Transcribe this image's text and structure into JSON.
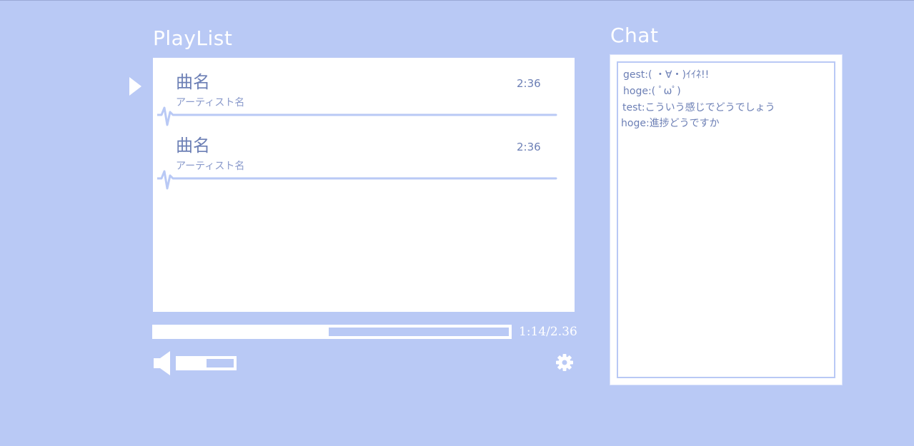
{
  "playlist": {
    "title": "PlayList",
    "tracks": [
      {
        "title": "曲名",
        "artist": "アーティスト名",
        "duration": "2:36"
      },
      {
        "title": "曲名",
        "artist": "アーティスト名",
        "duration": "2:36"
      }
    ],
    "now_playing_index": 0
  },
  "player": {
    "progress_fraction": 0.49,
    "time_readout": "1:14/2.36",
    "volume_fraction": 0.5
  },
  "chat": {
    "title": "Chat",
    "messages": [
      {
        "text": "gest:( ・∀・)ｲｲﾈ!!"
      },
      {
        "text": "hoge:( ﾟωﾟ)"
      },
      {
        "text": "test:こういう感じでどうでしょう"
      },
      {
        "text": "hoge:進捗どうですか"
      }
    ]
  },
  "colors": {
    "background": "#b9c9f5",
    "accent_text": "#6c7fb5",
    "panel": "#ffffff"
  },
  "icons": {
    "play_indicator": "play-triangle-icon",
    "speaker": "speaker-icon",
    "settings": "gear-icon",
    "wave": "waveform-icon"
  }
}
